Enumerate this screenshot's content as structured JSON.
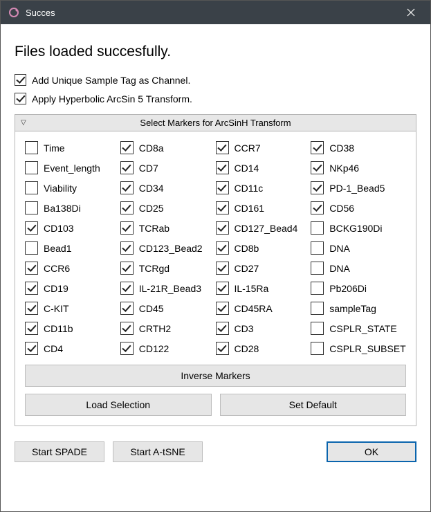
{
  "window": {
    "title": "Succes"
  },
  "heading": "Files loaded succesfully.",
  "top_checks": [
    {
      "label": "Add Unique Sample Tag as Channel.",
      "checked": true
    },
    {
      "label": "Apply Hyperbolic ArcSin 5 Transform.",
      "checked": true
    }
  ],
  "panel": {
    "title": "Select Markers for ArcSinH Transform",
    "markers": [
      {
        "label": "Time",
        "checked": false
      },
      {
        "label": "CD8a",
        "checked": true
      },
      {
        "label": "CCR7",
        "checked": true
      },
      {
        "label": "CD38",
        "checked": true
      },
      {
        "label": "Event_length",
        "checked": false
      },
      {
        "label": "CD7",
        "checked": true
      },
      {
        "label": "CD14",
        "checked": true
      },
      {
        "label": "NKp46",
        "checked": true
      },
      {
        "label": "Viability",
        "checked": false
      },
      {
        "label": "CD34",
        "checked": true
      },
      {
        "label": "CD11c",
        "checked": true
      },
      {
        "label": "PD-1_Bead5",
        "checked": true
      },
      {
        "label": "Ba138Di",
        "checked": false
      },
      {
        "label": "CD25",
        "checked": true
      },
      {
        "label": "CD161",
        "checked": true
      },
      {
        "label": "CD56",
        "checked": true
      },
      {
        "label": "CD103",
        "checked": true
      },
      {
        "label": "TCRab",
        "checked": true
      },
      {
        "label": "CD127_Bead4",
        "checked": true
      },
      {
        "label": "BCKG190Di",
        "checked": false
      },
      {
        "label": "Bead1",
        "checked": false
      },
      {
        "label": "CD123_Bead2",
        "checked": true
      },
      {
        "label": "CD8b",
        "checked": true
      },
      {
        "label": "DNA",
        "checked": false
      },
      {
        "label": "CCR6",
        "checked": true
      },
      {
        "label": "TCRgd",
        "checked": true
      },
      {
        "label": "CD27",
        "checked": true
      },
      {
        "label": "DNA",
        "checked": false
      },
      {
        "label": "CD19",
        "checked": true
      },
      {
        "label": "IL-21R_Bead3",
        "checked": true
      },
      {
        "label": "IL-15Ra",
        "checked": true
      },
      {
        "label": "Pb206Di",
        "checked": false
      },
      {
        "label": "C-KIT",
        "checked": true
      },
      {
        "label": "CD45",
        "checked": true
      },
      {
        "label": "CD45RA",
        "checked": true
      },
      {
        "label": "sampleTag",
        "checked": false
      },
      {
        "label": "CD11b",
        "checked": true
      },
      {
        "label": "CRTH2",
        "checked": true
      },
      {
        "label": "CD3",
        "checked": true
      },
      {
        "label": "CSPLR_STATE",
        "checked": false
      },
      {
        "label": "CD4",
        "checked": true
      },
      {
        "label": "CD122",
        "checked": true
      },
      {
        "label": "CD28",
        "checked": true
      },
      {
        "label": "CSPLR_SUBSET",
        "checked": false
      }
    ],
    "buttons": {
      "inverse": "Inverse Markers",
      "load": "Load Selection",
      "setdefault": "Set Default"
    }
  },
  "bottom": {
    "spade": "Start SPADE",
    "atsne": "Start A-tSNE",
    "ok": "OK"
  }
}
